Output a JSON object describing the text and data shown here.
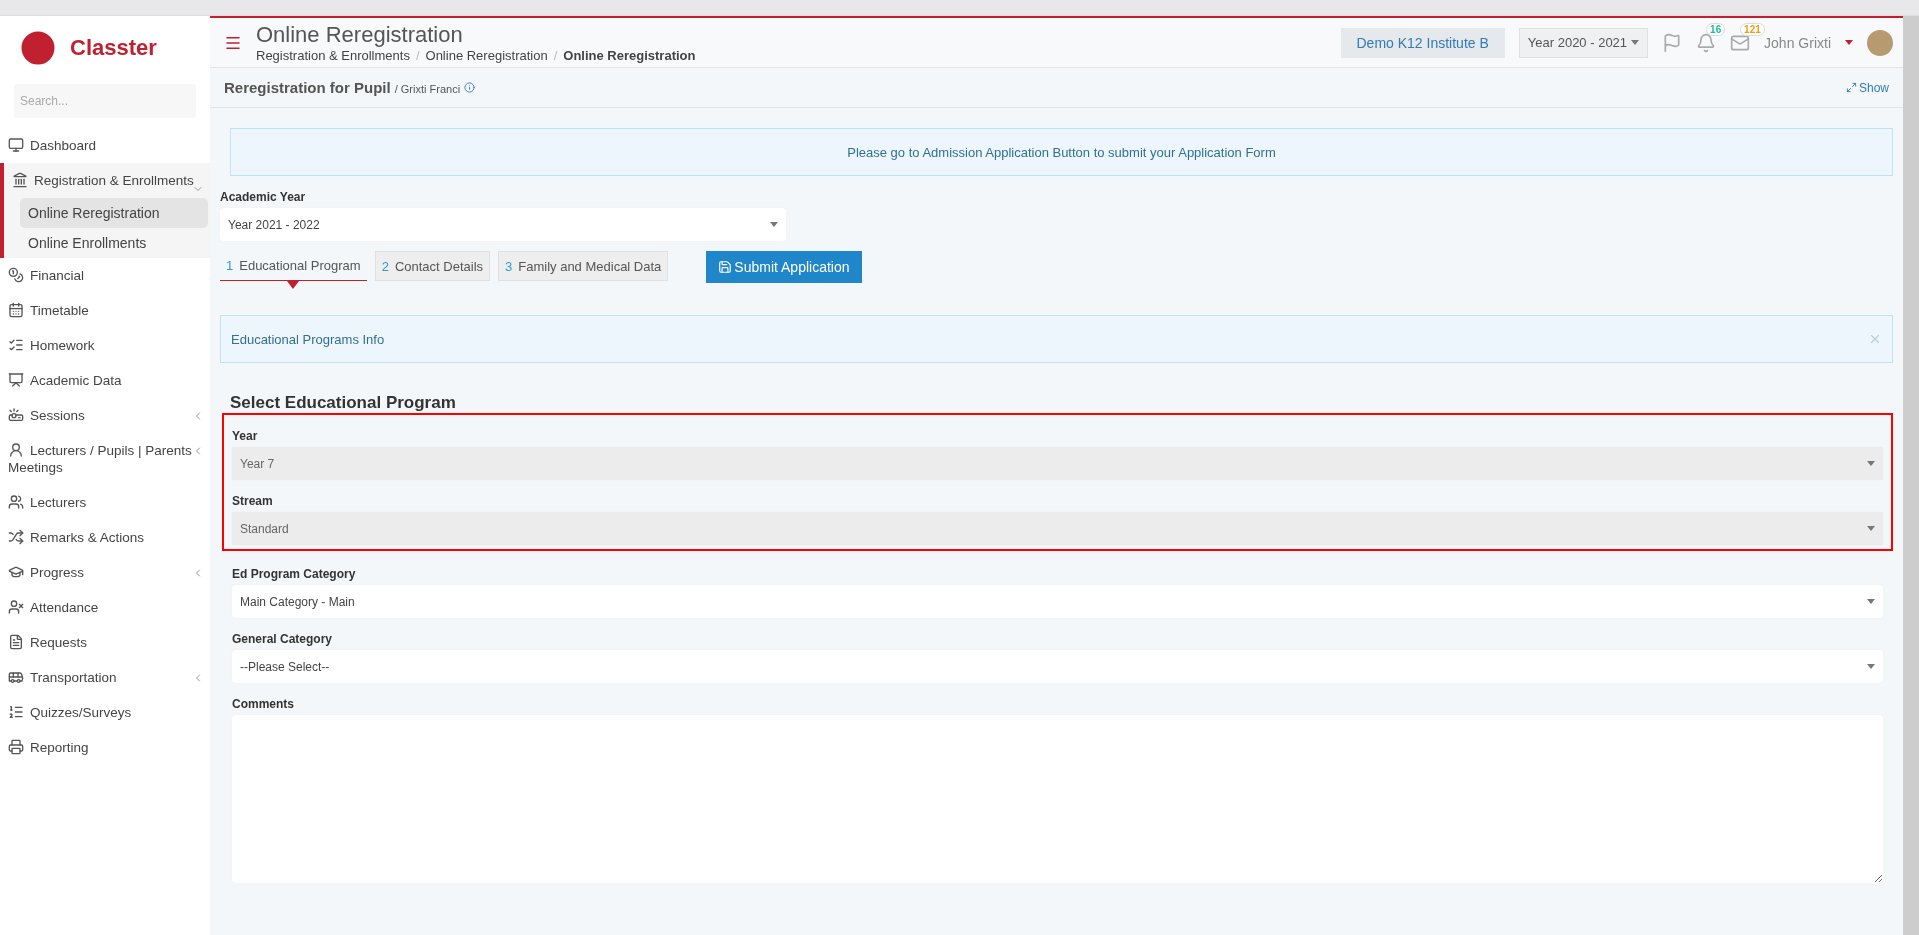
{
  "brand": {
    "name": "Classter"
  },
  "sidebar": {
    "search": {
      "placeholder": "Search..."
    },
    "items": [
      {
        "label": "Dashboard",
        "kind": "monitor",
        "expanded": false,
        "has_submenu": false
      },
      {
        "label": "Registration & Enrollments",
        "kind": "bank",
        "expanded": true,
        "has_submenu": true,
        "children": [
          {
            "label": "Online Reregistration",
            "selected": true
          },
          {
            "label": "Online Enrollments",
            "selected": false
          }
        ]
      },
      {
        "label": "Financial",
        "kind": "coins",
        "expanded": false,
        "has_submenu": false
      },
      {
        "label": "Timetable",
        "kind": "calendar",
        "expanded": false,
        "has_submenu": false
      },
      {
        "label": "Homework",
        "kind": "checklist",
        "expanded": false,
        "has_submenu": false
      },
      {
        "label": "Academic Data",
        "kind": "presentation",
        "expanded": false,
        "has_submenu": false
      },
      {
        "label": "Sessions",
        "kind": "sessions",
        "expanded": false,
        "has_submenu": true
      },
      {
        "label": "Lecturers / Pupils | Parents Meetings",
        "kind": "user-clock",
        "expanded": false,
        "has_submenu": true
      },
      {
        "label": "Lecturers",
        "kind": "users",
        "expanded": false,
        "has_submenu": false
      },
      {
        "label": "Remarks & Actions",
        "kind": "shuffle",
        "expanded": false,
        "has_submenu": false
      },
      {
        "label": "Progress",
        "kind": "cap",
        "expanded": false,
        "has_submenu": true
      },
      {
        "label": "Attendance",
        "kind": "user-x",
        "expanded": false,
        "has_submenu": false
      },
      {
        "label": "Requests",
        "kind": "file",
        "expanded": false,
        "has_submenu": false
      },
      {
        "label": "Transportation",
        "kind": "bus",
        "expanded": false,
        "has_submenu": true
      },
      {
        "label": "Quizzes/Surveys",
        "kind": "list",
        "expanded": false,
        "has_submenu": false
      },
      {
        "label": "Reporting",
        "kind": "printer",
        "expanded": false,
        "has_submenu": false
      }
    ]
  },
  "header": {
    "title": "Online Reregistration",
    "breadcrumb_separator": "/",
    "breadcrumbs": [
      "Registration & Enrollments",
      "Online Reregistration",
      "Online Reregistration"
    ],
    "institute": "Demo K12 Institute B",
    "year": "Year 2020 - 2021",
    "badges": [
      {
        "kind": "bell",
        "count": "16",
        "color": "#1abc9c"
      },
      {
        "kind": "mail",
        "count": "121",
        "color": "#f39c12"
      }
    ],
    "user": "John Grixti"
  },
  "subheader": {
    "title": "Reregistration for Pupil",
    "pupil": "/ Grixti Franci",
    "action": "Show"
  },
  "alert": "Please go to Admission Application Button to submit your Application Form",
  "academic_year": {
    "label": "Academic Year",
    "value": "Year 2021 - 2022"
  },
  "steps": [
    {
      "number": "1",
      "label": "Educational Program",
      "selected": true
    },
    {
      "number": "2",
      "label": "Contact Details",
      "selected": false
    },
    {
      "number": "3",
      "label": "Family and Medical Data",
      "selected": false
    }
  ],
  "submit": "Submit Application",
  "info": "Educational Programs Info",
  "section_title": "Select Educational Program",
  "groups": [
    {
      "highlighted": true,
      "fields": [
        {
          "kind": "select",
          "label": "Year",
          "value": "Year 7",
          "disabled": true
        },
        {
          "kind": "select",
          "label": "Stream",
          "value": "Standard",
          "disabled": true
        }
      ]
    },
    {
      "highlighted": false,
      "fields": [
        {
          "kind": "select",
          "label": "Ed Program Category",
          "value": "Main Category - Main",
          "disabled": false
        },
        {
          "kind": "select",
          "label": "General Category",
          "value": "--Please Select--",
          "disabled": false
        },
        {
          "kind": "textarea",
          "label": "Comments"
        }
      ]
    }
  ]
}
